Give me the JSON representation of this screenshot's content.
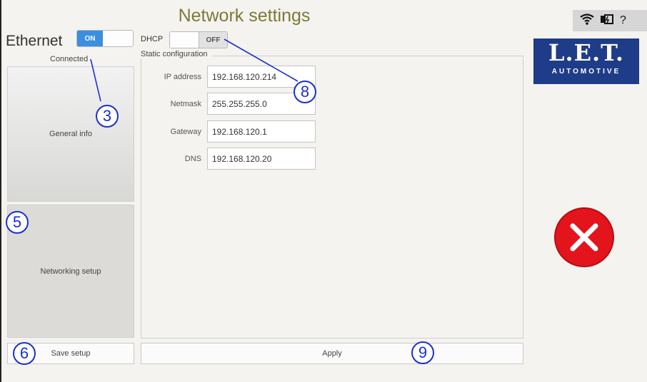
{
  "header": {
    "title": "Network settings"
  },
  "status_bar": {
    "icons": [
      "wifi-icon",
      "battery-plug-icon",
      "help-icon"
    ],
    "help_text": "?"
  },
  "ethernet": {
    "label": "Ethernet",
    "toggle_on_text": "ON",
    "state": "on",
    "status": "Connected"
  },
  "sidebar": {
    "general_info_label": "General info",
    "networking_setup_label": "Networking setup",
    "save_setup_label": "Save setup"
  },
  "dhcp": {
    "label": "DHCP",
    "toggle_off_text": "OFF",
    "state": "off"
  },
  "static_config": {
    "title": "Static configuration",
    "fields": [
      {
        "label": "IP address",
        "value": "192.168.120.214"
      },
      {
        "label": "Netmask",
        "value": "255.255.255.0"
      },
      {
        "label": "Gateway",
        "value": "192.168.120.1"
      },
      {
        "label": "DNS",
        "value": "192.168.120.20"
      }
    ]
  },
  "apply_label": "Apply",
  "logo": {
    "main": "L.E.T.",
    "sub": "AUTOMOTIVE"
  },
  "status_icon": "error-cross-icon",
  "callouts": [
    "3",
    "5",
    "6",
    "8",
    "9"
  ],
  "colors": {
    "accent": "#3b8ee0",
    "logo_bg": "#1f3c88",
    "error": "#e3141c",
    "callout": "#1b2fd0",
    "title": "#7a7a3a"
  }
}
